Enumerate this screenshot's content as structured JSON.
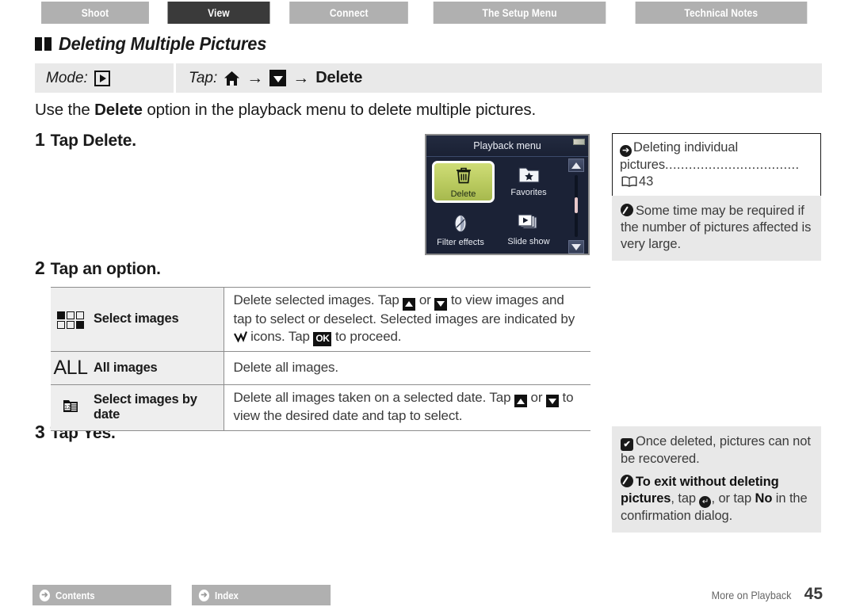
{
  "tabs": [
    {
      "label": "Shoot",
      "active": false
    },
    {
      "label": "View",
      "active": true
    },
    {
      "label": "Connect",
      "active": false
    },
    {
      "label": "The Setup Menu",
      "active": false
    },
    {
      "label": "Technical Notes",
      "active": false
    }
  ],
  "section": {
    "title": "Deleting Multiple Pictures"
  },
  "modebar": {
    "mode_label": "Mode:",
    "mode_icon": "playback-icon",
    "tap_label": "Tap:",
    "tap_icon_home": "home-icon",
    "tap_arrow": "→",
    "tap_icon_down": "down-triangle-icon",
    "tap_target": "Delete"
  },
  "intro": {
    "pre": "Use the ",
    "bold": "Delete",
    "post": " option in the playback menu to delete multiple pictures."
  },
  "steps": [
    {
      "num": "1",
      "text_pre": "Tap ",
      "text_bold": "Delete",
      "text_post": "."
    },
    {
      "num": "2",
      "text_pre": "Tap an option.",
      "text_bold": "",
      "text_post": ""
    },
    {
      "num": "3",
      "text_pre": "Tap ",
      "text_bold": "Yes",
      "text_post": "."
    }
  ],
  "lcd": {
    "title": "Playback menu",
    "battery_icon": "battery-icon",
    "selected_item": "Delete",
    "selected_icon": "trash-icon",
    "items": [
      {
        "label": "Favorites",
        "icon": "favorites-folder-icon"
      },
      {
        "label": "Filter effects",
        "icon": "filter-effects-icon"
      },
      {
        "label": "Slide show",
        "icon": "slide-show-icon"
      }
    ],
    "scroll_up_icon": "scroll-up-icon",
    "scroll_down_icon": "scroll-down-icon"
  },
  "notes": {
    "ref": {
      "icon": "arrow-circle-icon",
      "line1": "Deleting individual",
      "line2_pre": "pictures",
      "dots": "..................................",
      "book_icon": "book-icon",
      "page": "43"
    },
    "info1": {
      "icon": "pencil-note-icon",
      "text": "Some time may be required if the number of pictures affected is very large."
    },
    "caution": {
      "icon": "check-mark-icon",
      "text": "Once deleted, pictures can not be recovered."
    },
    "info2": {
      "icon": "pencil-note-icon",
      "bold_lead": "To exit without deleting pictures",
      "mid": ", tap ",
      "back_icon": "back-circle-icon",
      "mid2": ", or tap ",
      "bold_no": "No",
      "tail": " in the confirmation dialog."
    }
  },
  "table": {
    "rows": [
      {
        "icon": "select-images-grid-icon",
        "name": "Select images",
        "desc_parts": [
          {
            "t": "text",
            "v": "Delete selected images. Tap "
          },
          {
            "t": "icon",
            "v": "up-triangle-icon"
          },
          {
            "t": "text",
            "v": " or "
          },
          {
            "t": "icon",
            "v": "down-triangle-icon"
          },
          {
            "t": "text",
            "v": " to view images and tap to select or deselect. Selected images are indicated by "
          },
          {
            "t": "icon",
            "v": "check-tick-icon"
          },
          {
            "t": "text",
            "v": " icons. Tap "
          },
          {
            "t": "icon",
            "v": "ok-button-icon"
          },
          {
            "t": "text",
            "v": " to proceed."
          }
        ]
      },
      {
        "icon": "all-images-icon",
        "icon_text": "ALL",
        "name": "All images",
        "desc_parts": [
          {
            "t": "text",
            "v": "Delete all images."
          }
        ]
      },
      {
        "icon": "calendar-date-icon",
        "name": "Select images by date",
        "desc_parts": [
          {
            "t": "text",
            "v": "Delete all images taken on a selected date. Tap "
          },
          {
            "t": "icon",
            "v": "up-triangle-icon"
          },
          {
            "t": "text",
            "v": " or "
          },
          {
            "t": "icon",
            "v": "down-triangle-icon"
          },
          {
            "t": "text",
            "v": " to view the desired date and tap to select."
          }
        ]
      }
    ]
  },
  "footer": {
    "nav": [
      {
        "label": "Contents",
        "icon": "arrow-circle-icon"
      },
      {
        "label": "Index",
        "icon": "arrow-circle-icon"
      }
    ],
    "section_name": "More on Playback",
    "page_number": "45"
  },
  "colors": {
    "tab_inactive": "#b0b0b0",
    "tab_active": "#3a3a3a",
    "mode_bar": "#e9e9e9",
    "note_gray": "#e8e8e8",
    "lcd_bg": "#1b2236",
    "lcd_highlight": "#bfd06a"
  }
}
